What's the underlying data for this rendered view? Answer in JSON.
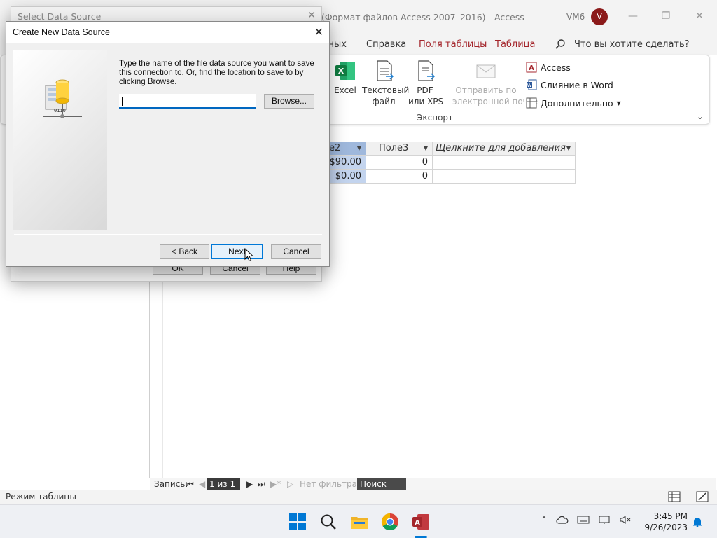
{
  "access_window": {
    "title": "(Формат файлов Access 2007–2016)  -  Access",
    "user": "VM6",
    "avatar_letter": "V",
    "accent": "#a4262c"
  },
  "ribbon": {
    "tabs": [
      "нных",
      "Справка",
      "Поля таблицы",
      "Таблица"
    ],
    "tell_me": "Что вы хотите сделать?",
    "export_buttons": {
      "excel": "Excel",
      "text_file": "Текстовый\nфайл",
      "pdf_xps": "PDF\nили XPS",
      "email": "Отправить по\nэлектронной почте"
    },
    "small_buttons": {
      "access": "Access",
      "word_merge": "Слияние в Word",
      "more": "Дополнительно"
    },
    "group_label": "Экспорт"
  },
  "datasheet": {
    "headers": [
      "e2",
      "Поле3",
      "Щелкните для добавления"
    ],
    "rows": [
      [
        "$90.00",
        "0"
      ],
      [
        "$0.00",
        "0"
      ]
    ],
    "selection_color": "#c3d4ee"
  },
  "record_nav": {
    "label": "Запись:",
    "current": "1 из 1",
    "filter": "Нет фильтра",
    "search": "Поиск"
  },
  "status_bar": {
    "mode": "Режим таблицы"
  },
  "select_data_source": {
    "title": "Select Data Source",
    "ok": "OK",
    "cancel": "Cancel",
    "help": "Help"
  },
  "create_new_data_source": {
    "title": "Create New Data Source",
    "instructions": "Type the name of the file data source you want to save this connection to.  Or, find the location to save to by clicking Browse.",
    "file_name_value": "",
    "browse": "Browse...",
    "back": "< Back",
    "next": "Next",
    "cancel": "Cancel"
  },
  "taskbar": {
    "time": "3:45 PM",
    "date": "9/26/2023",
    "pinned": [
      "start-icon",
      "search-icon",
      "file-explorer-icon",
      "chrome-icon",
      "access-icon"
    ]
  }
}
